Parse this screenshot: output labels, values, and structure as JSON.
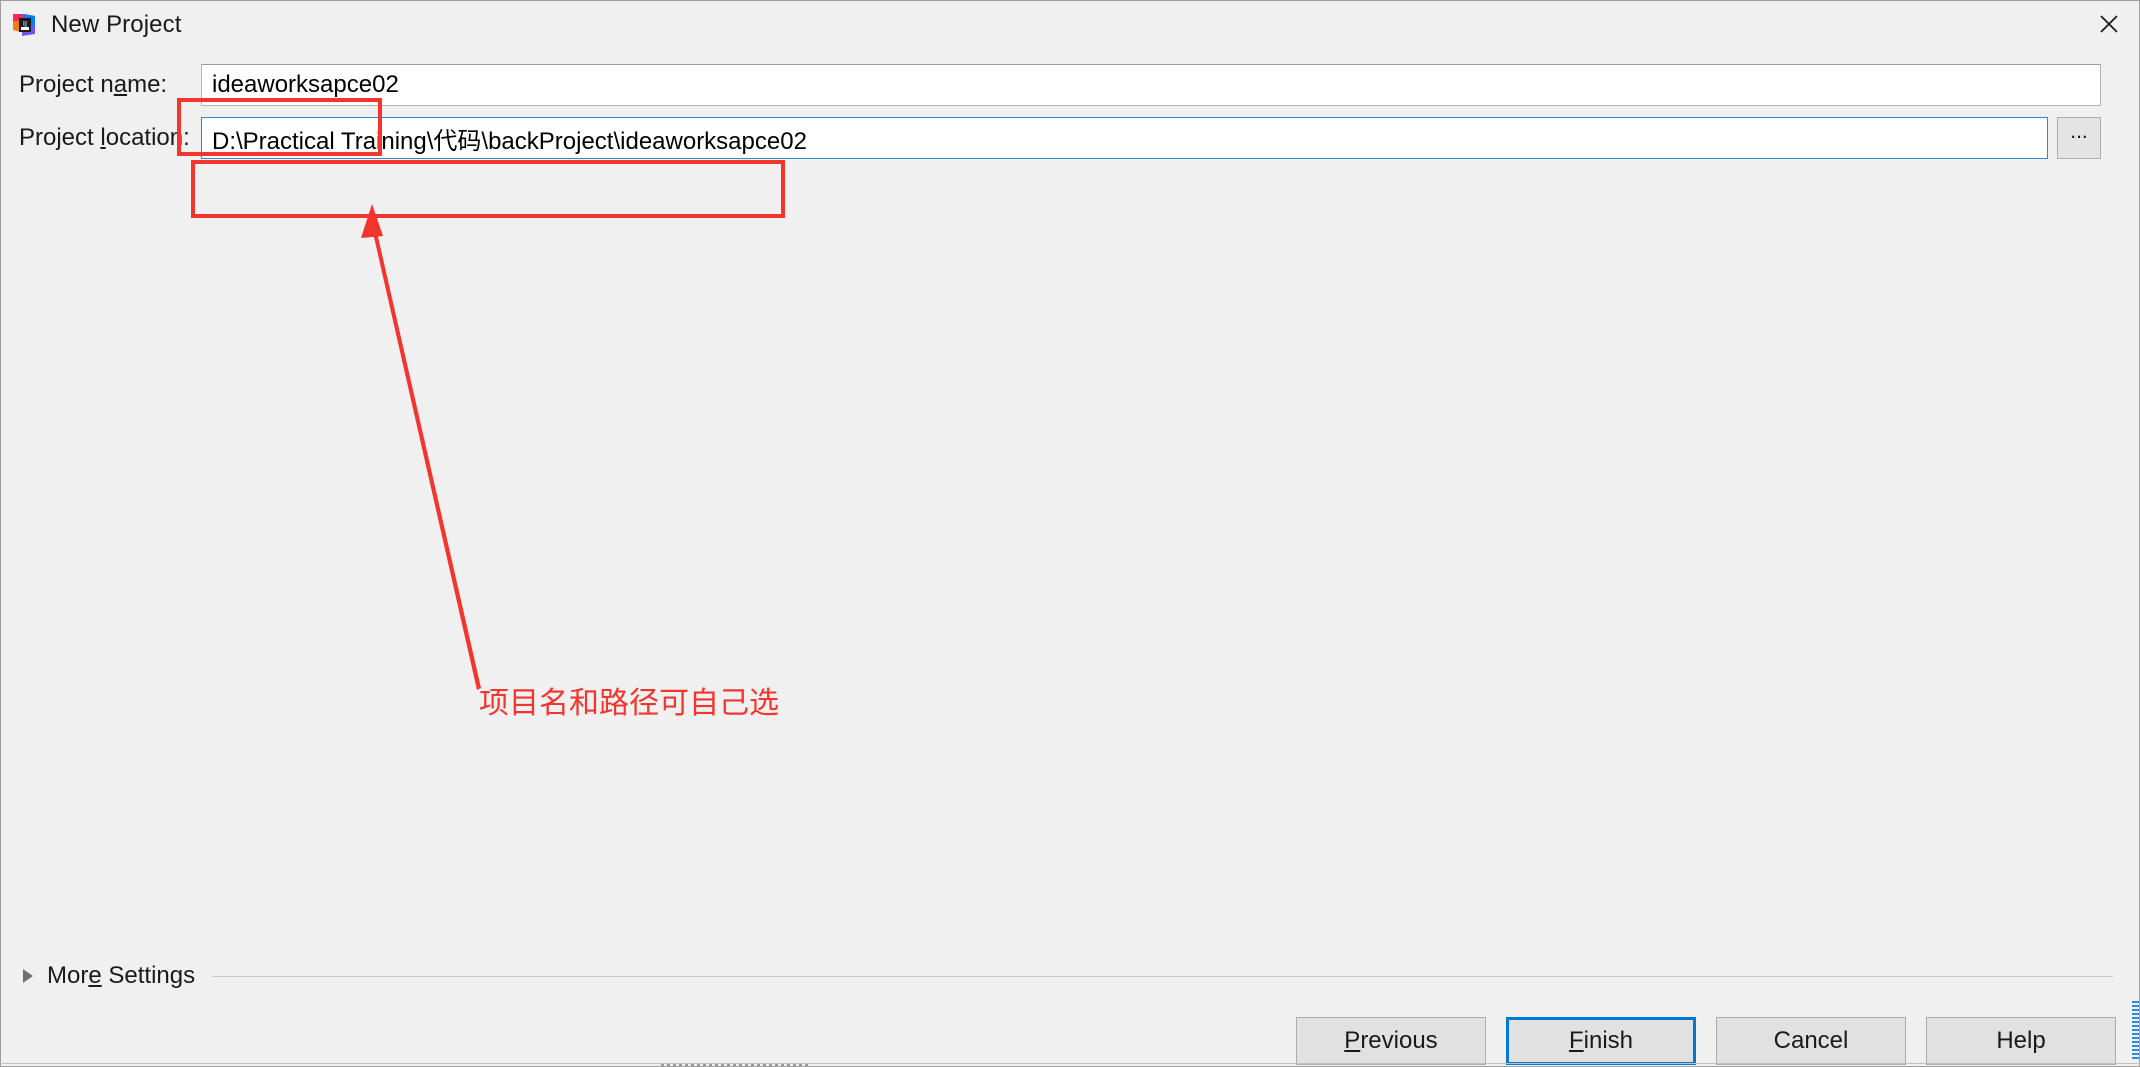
{
  "window": {
    "title": "New Project",
    "app_icon": "intellij-idea-icon",
    "close_icon": "close-icon"
  },
  "form": {
    "name_field": {
      "label_before": "Project n",
      "label_mnemonic": "a",
      "label_after": "me:",
      "value": "ideaworksapce02"
    },
    "location_field": {
      "label_before": "Project ",
      "label_mnemonic": "l",
      "label_after": "ocation:",
      "value": "D:\\Practical Training\\代码\\backProject\\ideaworksapce02"
    },
    "browse_button": {
      "label": "...",
      "icon": "ellipsis-icon"
    }
  },
  "more_settings": {
    "expander_icon": "chevron-right-icon",
    "label_before": "Mor",
    "label_mnemonic": "e",
    "label_after": " Settings"
  },
  "buttons": [
    {
      "name": "previous",
      "before": "",
      "mnemonic": "P",
      "after": "revious",
      "focused": false
    },
    {
      "name": "finish",
      "before": "",
      "mnemonic": "F",
      "after": "inish",
      "focused": true
    },
    {
      "name": "cancel",
      "before": "Cancel",
      "mnemonic": "",
      "after": "",
      "focused": false
    },
    {
      "name": "help",
      "before": "Help",
      "mnemonic": "",
      "after": "",
      "focused": false
    }
  ],
  "annotations": {
    "color": "#f3352e",
    "note_text": "项目名和路径可自己选",
    "highlight_name_field": true,
    "highlight_location_field": true,
    "arrow": "red-arrow-pointing-to-location-field"
  }
}
